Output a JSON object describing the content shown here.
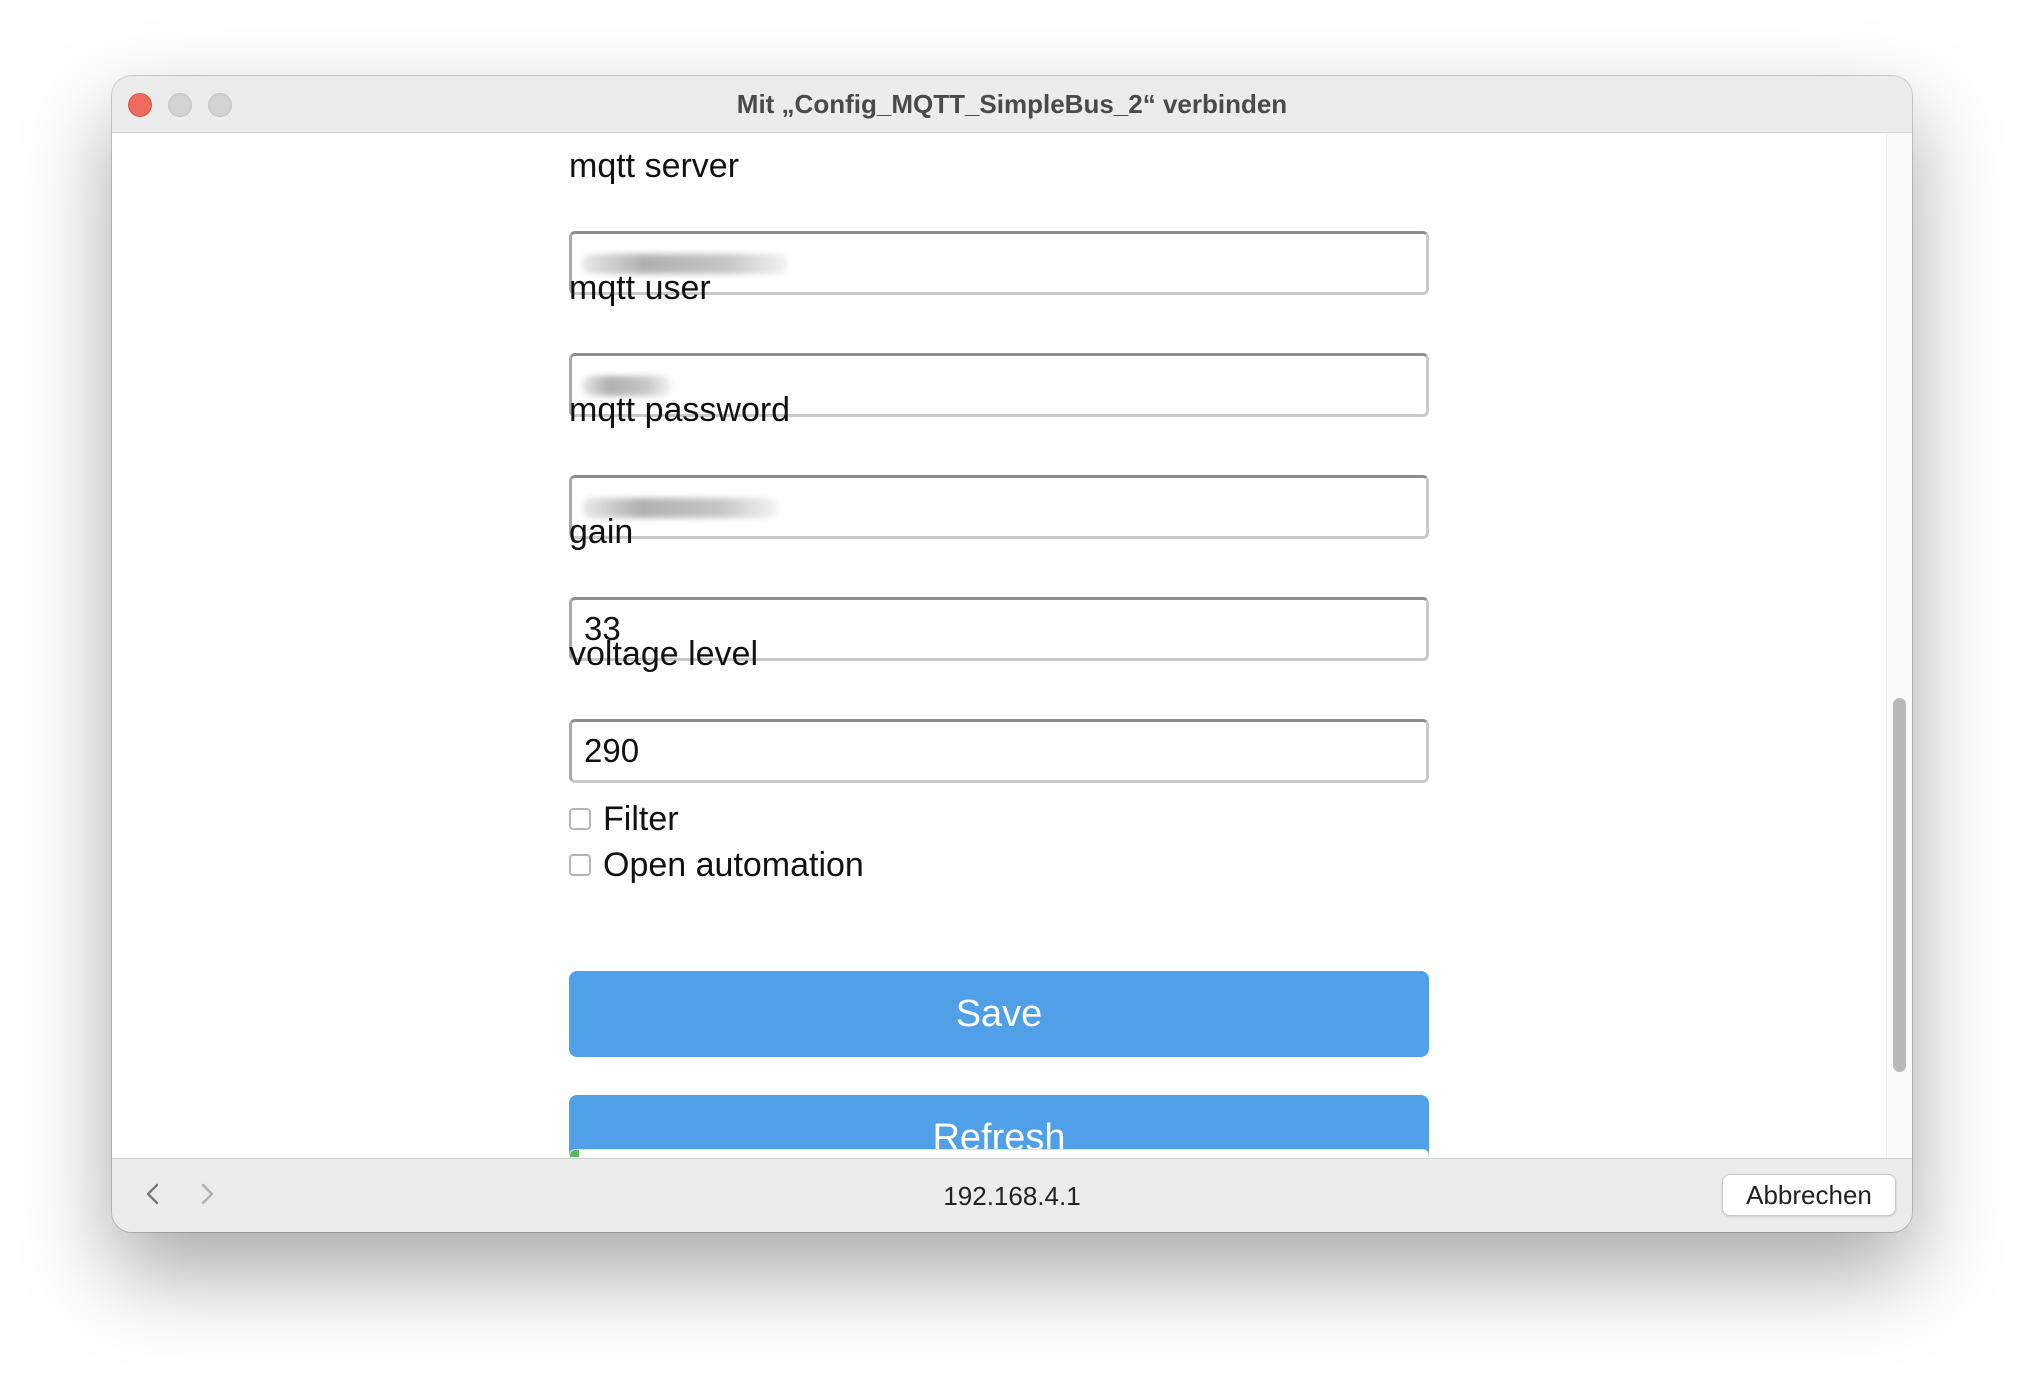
{
  "window": {
    "title": "Mit „Config_MQTT_SimpleBus_2“ verbinden"
  },
  "form": {
    "fields": [
      {
        "label": "mqtt server",
        "value": "",
        "redacted": true
      },
      {
        "label": "mqtt user",
        "value": "",
        "redacted": true
      },
      {
        "label": "mqtt password",
        "value": "",
        "redacted": true
      },
      {
        "label": "gain",
        "value": "33"
      },
      {
        "label": "voltage level",
        "value": "290"
      }
    ],
    "checkboxes": [
      {
        "label": "Filter",
        "checked": false
      },
      {
        "label": "Open automation",
        "checked": false
      }
    ],
    "save_label": "Save",
    "refresh_label": "Refresh"
  },
  "progress": {
    "value_fraction": 0.01,
    "color": "#5bb85d"
  },
  "bottombar": {
    "url": "192.168.4.1",
    "cancel_label": "Abbrechen"
  },
  "colors": {
    "button": "#4fa0e6",
    "close": "#ed6a5e"
  },
  "icons": {
    "back": "chevron-left-icon",
    "forward": "chevron-right-icon"
  }
}
